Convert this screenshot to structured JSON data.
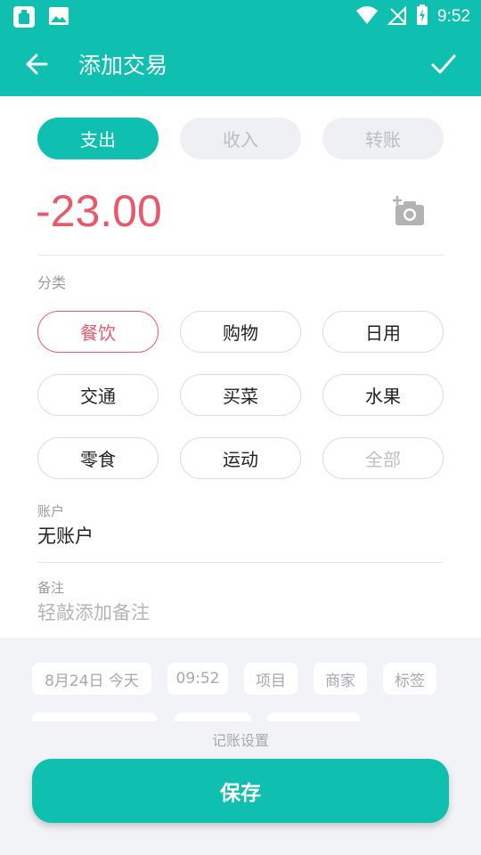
{
  "status_bar": {
    "time": "9:52"
  },
  "app_bar": {
    "title": "添加交易"
  },
  "type_tabs": [
    {
      "label": "支出",
      "active": true
    },
    {
      "label": "收入",
      "active": false
    },
    {
      "label": "转账",
      "active": false
    }
  ],
  "amount": "-23.00",
  "category": {
    "label": "分类",
    "items": [
      "餐饮",
      "购物",
      "日用",
      "交通",
      "买菜",
      "水果",
      "零食",
      "运动",
      "全部"
    ],
    "selected": "餐饮"
  },
  "account": {
    "label": "账户",
    "value": "无账户"
  },
  "note": {
    "label": "备注",
    "placeholder": "轻敲添加备注"
  },
  "chips": {
    "date": "8月24日  今天",
    "time": "09:52",
    "project": "项目",
    "merchant": "商家",
    "tag": "标签"
  },
  "settings_label": "记账设置",
  "save_label": "保存",
  "colors": {
    "accent": "#0fbfb0",
    "expense": "#e85a6b",
    "panel": "#f2f3f7"
  }
}
